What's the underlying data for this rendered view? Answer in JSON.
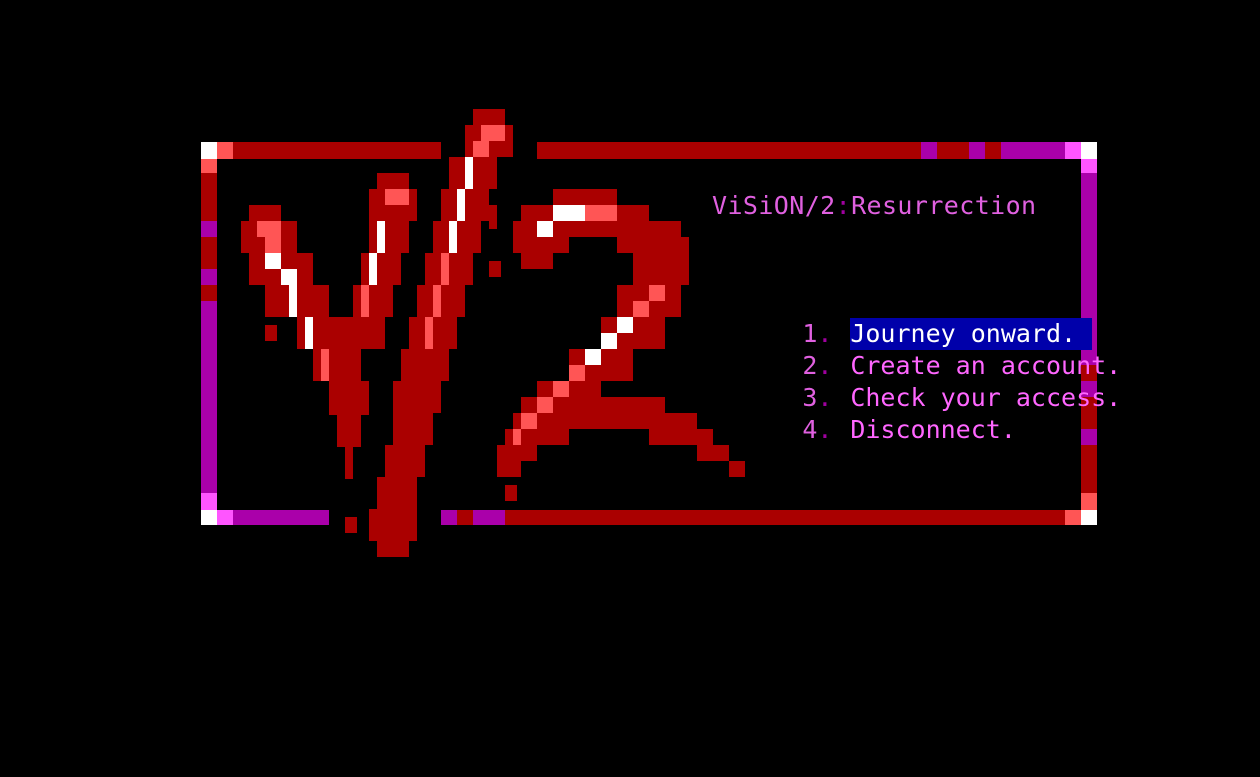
{
  "app": {
    "title_left": "ViSiON/2",
    "title_separator": ":",
    "title_right": "Resurrection",
    "logo_text": "V/2"
  },
  "menu": {
    "items": [
      {
        "number": "1",
        "label": "Journey onward.",
        "selected": true
      },
      {
        "number": "2",
        "label": "Create an account.",
        "selected": false
      },
      {
        "number": "3",
        "label": "Check your access.",
        "selected": false
      },
      {
        "number": "4",
        "label": "Disconnect.",
        "selected": false
      }
    ]
  },
  "colors": {
    "background": "#000000",
    "frame_red": "#aa0000",
    "frame_magenta": "#aa00aa",
    "frame_pink": "#ff5555",
    "frame_bright_magenta": "#ff55ff",
    "logo_dark": "#aa0000",
    "logo_light": "#ff5555",
    "logo_highlight": "#ffffff",
    "menu_text": "#ff66ff",
    "selection_bg": "#0000aa",
    "selection_text": "#ffffff"
  }
}
